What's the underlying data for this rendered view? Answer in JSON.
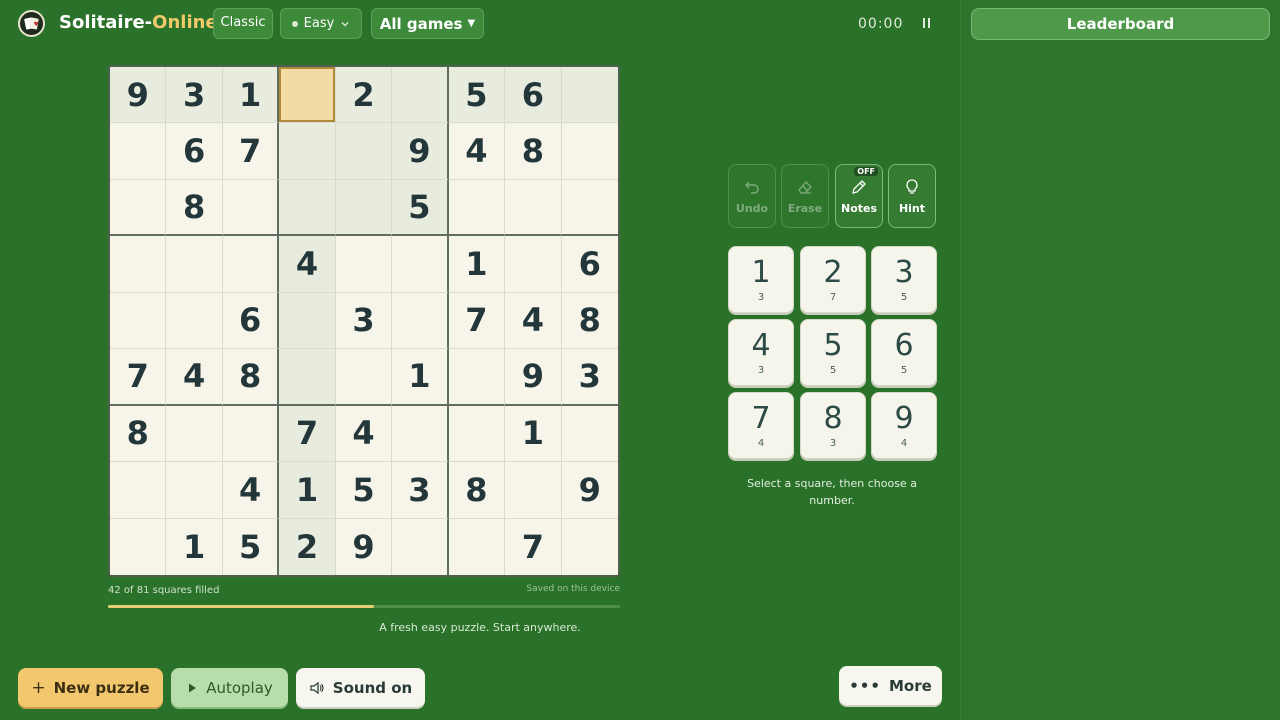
{
  "header": {
    "brand_main": "Solitaire-",
    "brand_accent": "Online",
    "mode": "Classic",
    "difficulty": "Easy",
    "games_menu": "All games",
    "timer": "00:00"
  },
  "sidebar": {
    "leaderboard_label": "Leaderboard"
  },
  "board": {
    "grid": [
      [
        "9",
        "3",
        "1",
        "",
        "2",
        "",
        "5",
        "6",
        ""
      ],
      [
        "",
        "6",
        "7",
        "",
        "",
        "9",
        "4",
        "8",
        ""
      ],
      [
        "",
        "8",
        "",
        "",
        "",
        "5",
        "",
        "",
        ""
      ],
      [
        "",
        "",
        "",
        "4",
        "",
        "",
        "1",
        "",
        "6"
      ],
      [
        "",
        "",
        "6",
        "",
        "3",
        "",
        "7",
        "4",
        "8"
      ],
      [
        "7",
        "4",
        "8",
        "",
        "",
        "1",
        "",
        "9",
        "3"
      ],
      [
        "8",
        "",
        "",
        "7",
        "4",
        "",
        "",
        "1",
        ""
      ],
      [
        "",
        "",
        "4",
        "1",
        "5",
        "3",
        "8",
        "",
        "9"
      ],
      [
        "",
        "1",
        "5",
        "2",
        "9",
        "",
        "",
        "7",
        ""
      ]
    ],
    "selected": [
      0,
      3
    ],
    "filled_text": "42 of 81 squares filled",
    "saved_text": "Saved on this device",
    "progress": 0.52,
    "status_message": "A fresh easy puzzle. Start anywhere."
  },
  "tools": {
    "undo": "Undo",
    "erase": "Erase",
    "notes": "Notes",
    "notes_badge": "OFF",
    "hint": "Hint"
  },
  "keypad": [
    {
      "number": "1",
      "count": "3"
    },
    {
      "number": "2",
      "count": "7"
    },
    {
      "number": "3",
      "count": "5"
    },
    {
      "number": "4",
      "count": "3"
    },
    {
      "number": "5",
      "count": "5"
    },
    {
      "number": "6",
      "count": "5"
    },
    {
      "number": "7",
      "count": "4"
    },
    {
      "number": "8",
      "count": "3"
    },
    {
      "number": "9",
      "count": "4"
    }
  ],
  "keypad_hint": "Select a square, then choose a number.",
  "footer": {
    "new_puzzle": "New puzzle",
    "autoplay": "Autoplay",
    "sound": "Sound on",
    "more": "More"
  },
  "colors": {
    "background": "#2a7129",
    "accent": "#f0c96a",
    "cell": "#f7f5ea",
    "selected_cell": "#f2dca4"
  }
}
